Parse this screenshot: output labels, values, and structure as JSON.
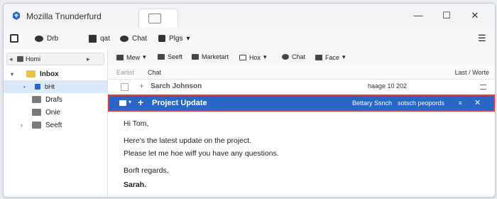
{
  "window": {
    "title": "Mozilla Tnunderfurd"
  },
  "title_controls": {
    "minimize": "—",
    "maximize": "☐",
    "close": "✕"
  },
  "toolbar": {
    "items": [
      {
        "label": ""
      },
      {
        "label": "Drb"
      },
      {
        "label": "qat"
      },
      {
        "label": "Chat"
      },
      {
        "label": "Plgs"
      }
    ],
    "menu_icon": "☰"
  },
  "sidebar": {
    "home_label": "Homi",
    "folders": [
      {
        "name": "Inbox",
        "expanded": true
      },
      {
        "name": "bHt",
        "selected": true
      },
      {
        "name": "Drafs"
      },
      {
        "name": "Onie"
      },
      {
        "name": "Seeft"
      }
    ]
  },
  "message_toolbar": {
    "items": [
      {
        "label": "Mew"
      },
      {
        "label": "Seeft"
      },
      {
        "label": "Marketart"
      },
      {
        "label": "Hox"
      },
      {
        "label": "Chat"
      },
      {
        "label": "Face"
      }
    ]
  },
  "columns": {
    "left1": "Earlist",
    "left2": "Chat",
    "right": "Last / Worte"
  },
  "messages": [
    {
      "subject": "Sarch Johnson",
      "date": "haage 10 202",
      "selected": false
    },
    {
      "subject": "Project Update",
      "sender": "Bettary Ssnch",
      "action": "sotsch peopords",
      "selected": true
    }
  ],
  "body": {
    "greeting": "Hi Tom,",
    "line1": "Here's the latest update on the project.",
    "line2": "Please let me hoe wiff you have any questions.",
    "closing": "Borft regards,",
    "signature": "Sarah."
  },
  "colors": {
    "accent": "#2a66c5",
    "highlight_border": "#e03b34",
    "selected_folder_bg": "#dce9f8",
    "inbox_folder": "#f0c24b"
  }
}
